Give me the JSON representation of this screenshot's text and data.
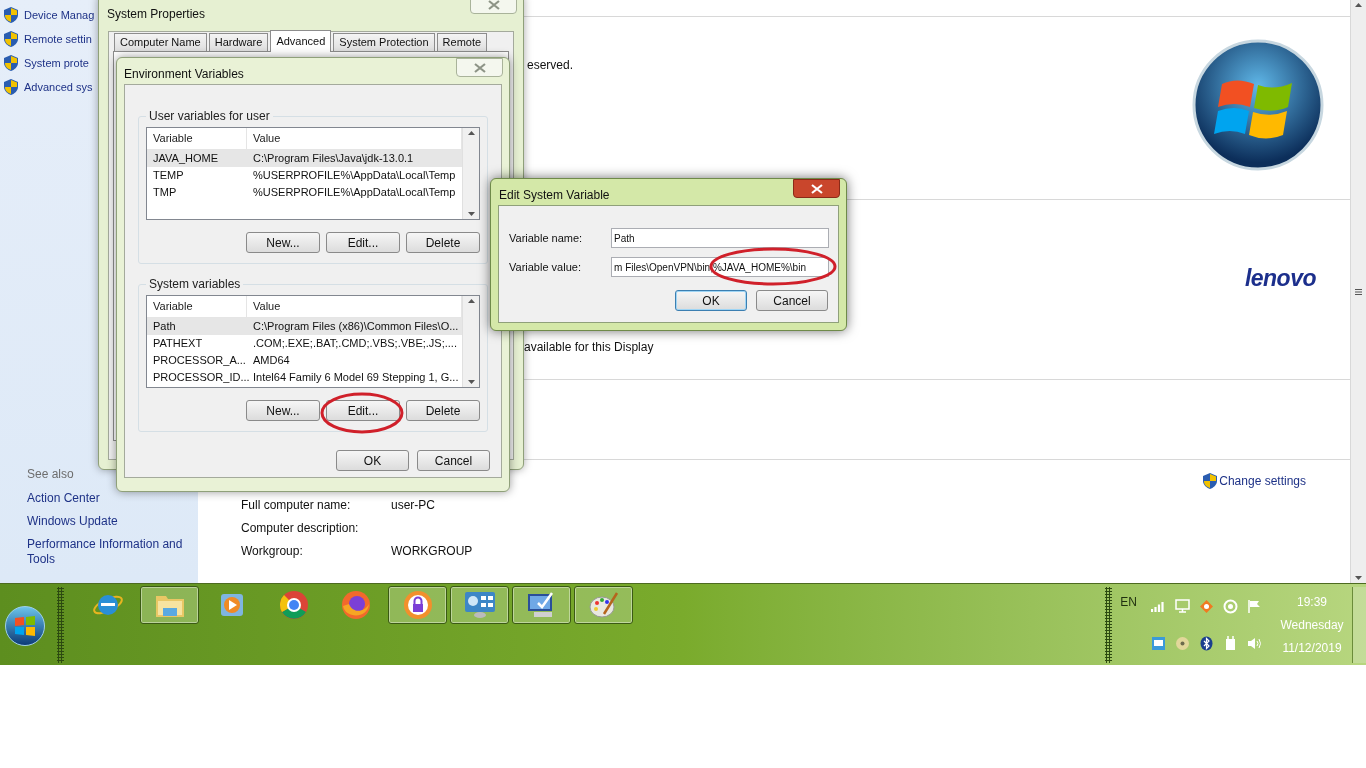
{
  "control_panel": {
    "sidebar_tasks": [
      "Device Manag",
      "Remote settin",
      "System prote",
      "Advanced sys"
    ],
    "see_also": {
      "title": "See also",
      "links": [
        "Action Center",
        "Windows Update",
        "Performance Information and Tools"
      ]
    },
    "copyright_fragment": "eserved.",
    "oem_logo": "lenovo",
    "display_note": "available for this Display",
    "change_settings": "Change settings",
    "computer_info": [
      {
        "label": "Full computer name:",
        "value": "user-PC"
      },
      {
        "label": "Computer description:"
      },
      {
        "label": "Workgroup:",
        "value": "WORKGROUP"
      }
    ]
  },
  "system_properties": {
    "title": "System Properties",
    "active": false,
    "tabs": [
      {
        "label": "Computer Name",
        "selected": false
      },
      {
        "label": "Hardware",
        "selected": false
      },
      {
        "label": "Advanced",
        "selected": true
      },
      {
        "label": "System Protection",
        "selected": false
      },
      {
        "label": "Remote",
        "selected": false
      }
    ]
  },
  "environment_variables": {
    "title": "Environment Variables",
    "active": false,
    "user_group": {
      "title": "User variables for user",
      "columns": [
        "Variable",
        "Value"
      ],
      "rows": [
        {
          "variable": "JAVA_HOME",
          "value": "C:\\Program Files\\Java\\jdk-13.0.1",
          "selected": true
        },
        {
          "variable": "TEMP",
          "value": "%USERPROFILE%\\AppData\\Local\\Temp",
          "selected": false
        },
        {
          "variable": "TMP",
          "value": "%USERPROFILE%\\AppData\\Local\\Temp",
          "selected": false
        }
      ],
      "buttons": [
        "New...",
        "Edit...",
        "Delete"
      ]
    },
    "system_group": {
      "title": "System variables",
      "columns": [
        "Variable",
        "Value"
      ],
      "rows": [
        {
          "variable": "Path",
          "value": "C:\\Program Files (x86)\\Common Files\\O...",
          "selected": true
        },
        {
          "variable": "PATHEXT",
          "value": ".COM;.EXE;.BAT;.CMD;.VBS;.VBE;.JS;....",
          "selected": false
        },
        {
          "variable": "PROCESSOR_A...",
          "value": "AMD64",
          "selected": false
        },
        {
          "variable": "PROCESSOR_ID...",
          "value": "Intel64 Family 6 Model 69 Stepping 1, G...",
          "selected": false
        }
      ],
      "buttons": [
        "New...",
        "Edit...",
        "Delete"
      ]
    },
    "buttons": [
      "OK",
      "Cancel"
    ]
  },
  "edit_system_variable": {
    "title": "Edit System Variable",
    "active": true,
    "fields": [
      {
        "label": "Variable name:",
        "value": "Path"
      },
      {
        "label": "Variable value:",
        "value": "m Files\\OpenVPN\\bin;%JAVA_HOME%\\bin"
      }
    ],
    "buttons": [
      {
        "label": "OK",
        "default": true
      },
      {
        "label": "Cancel",
        "default": false
      }
    ]
  },
  "taskbar": {
    "apps": [
      {
        "kind": "ie",
        "running": false
      },
      {
        "kind": "folder",
        "running": true
      },
      {
        "kind": "media",
        "running": false
      },
      {
        "kind": "chrome",
        "running": false
      },
      {
        "kind": "firefox",
        "running": false
      },
      {
        "kind": "lock",
        "running": true
      },
      {
        "kind": "dashboard",
        "running": true
      },
      {
        "kind": "monitor",
        "running": true
      },
      {
        "kind": "palette",
        "running": true
      }
    ],
    "language": "EN",
    "time": "19:39",
    "day": "Wednesday",
    "date": "11/12/2019"
  }
}
